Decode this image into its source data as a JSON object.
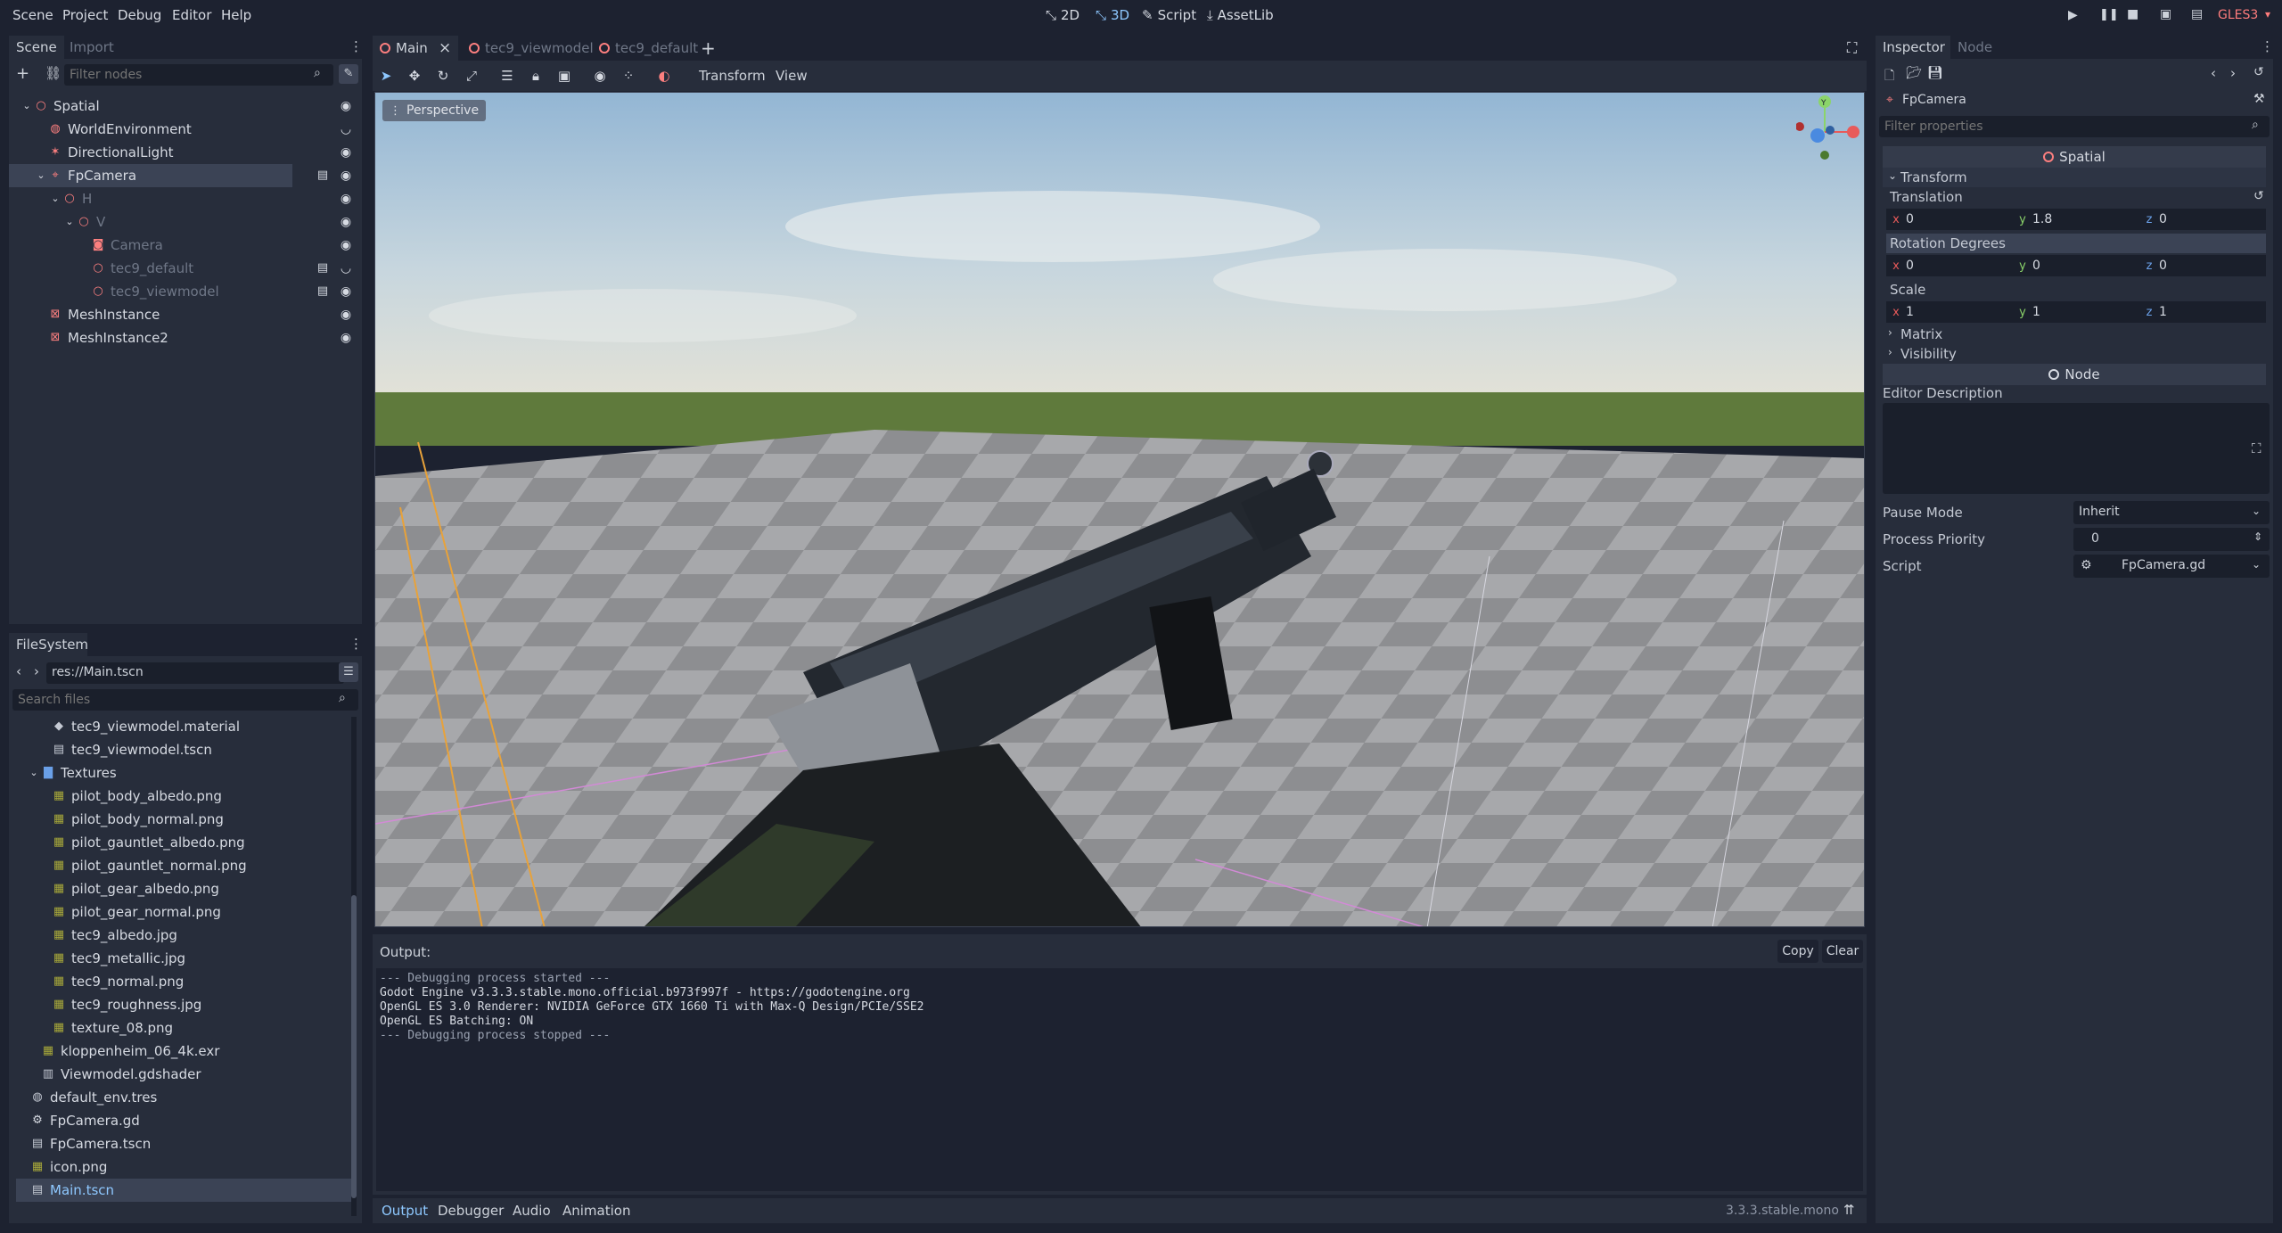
{
  "menu": [
    "Scene",
    "Project",
    "Debug",
    "Editor",
    "Help"
  ],
  "modes": {
    "m2d": "2D",
    "m3d": "3D",
    "script": "Script",
    "assetlib": "AssetLib"
  },
  "renderer": "GLES3",
  "scene_dock": {
    "tabs": [
      "Scene",
      "Import"
    ],
    "filter_placeholder": "Filter nodes",
    "nodes": [
      {
        "label": "Spatial",
        "depth": 0,
        "icon": "spatial-icon",
        "color": "#fc7f7f",
        "eye": true
      },
      {
        "label": "WorldEnvironment",
        "depth": 1,
        "icon": "world-environment-icon",
        "color": "#fc7f7f",
        "eye": false
      },
      {
        "label": "DirectionalLight",
        "depth": 1,
        "icon": "directional-light-icon",
        "color": "#fc7f7f",
        "eye": true
      },
      {
        "label": "FpCamera",
        "depth": 1,
        "icon": "fpcamera-icon",
        "color": "#fc7f7f",
        "eye": true,
        "selected": true
      },
      {
        "label": "H",
        "depth": 2,
        "icon": "spatial-icon",
        "color": "#fc7f7f",
        "eye": true,
        "dim": true
      },
      {
        "label": "V",
        "depth": 3,
        "icon": "spatial-icon",
        "color": "#fc7f7f",
        "eye": true,
        "dim": true
      },
      {
        "label": "Camera",
        "depth": 4,
        "icon": "camera-icon",
        "color": "#fc7f7f",
        "eye": true,
        "dim": true
      },
      {
        "label": "tec9_default",
        "depth": 4,
        "icon": "spatial-icon",
        "color": "#fc7f7f",
        "eye": false,
        "dim": true
      },
      {
        "label": "tec9_viewmodel",
        "depth": 4,
        "icon": "spatial-icon",
        "color": "#fc7f7f",
        "eye": true,
        "dim": true
      },
      {
        "label": "MeshInstance",
        "depth": 1,
        "icon": "mesh-instance-icon",
        "color": "#fc7f7f",
        "eye": true
      },
      {
        "label": "MeshInstance2",
        "depth": 1,
        "icon": "mesh-instance-icon",
        "color": "#fc7f7f",
        "eye": true
      }
    ]
  },
  "filesystem": {
    "title": "FileSystem",
    "path": "res://Main.tscn",
    "search_placeholder": "Search files",
    "items": [
      {
        "label": "tec9_viewmodel.material",
        "depth": 2,
        "icon": "material-icon"
      },
      {
        "label": "tec9_viewmodel.tscn",
        "depth": 2,
        "icon": "scene-file-icon"
      },
      {
        "label": "Textures",
        "depth": 1,
        "icon": "folder-icon"
      },
      {
        "label": "pilot_body_albedo.png",
        "depth": 2,
        "icon": "image-file-icon"
      },
      {
        "label": "pilot_body_normal.png",
        "depth": 2,
        "icon": "image-file-icon"
      },
      {
        "label": "pilot_gauntlet_albedo.png",
        "depth": 2,
        "icon": "image-file-icon"
      },
      {
        "label": "pilot_gauntlet_normal.png",
        "depth": 2,
        "icon": "image-file-icon"
      },
      {
        "label": "pilot_gear_albedo.png",
        "depth": 2,
        "icon": "image-file-icon"
      },
      {
        "label": "pilot_gear_normal.png",
        "depth": 2,
        "icon": "image-file-icon"
      },
      {
        "label": "tec9_albedo.jpg",
        "depth": 2,
        "icon": "image-file-icon"
      },
      {
        "label": "tec9_metallic.jpg",
        "depth": 2,
        "icon": "image-file-icon"
      },
      {
        "label": "tec9_normal.png",
        "depth": 2,
        "icon": "image-file-icon"
      },
      {
        "label": "tec9_roughness.jpg",
        "depth": 2,
        "icon": "image-file-icon"
      },
      {
        "label": "texture_08.png",
        "depth": 2,
        "icon": "image-file-icon"
      },
      {
        "label": "kloppenheim_06_4k.exr",
        "depth": 1,
        "icon": "image-file-icon"
      },
      {
        "label": "Viewmodel.gdshader",
        "depth": 1,
        "icon": "shader-file-icon"
      },
      {
        "label": "default_env.tres",
        "depth": 0,
        "icon": "environment-file-icon"
      },
      {
        "label": "FpCamera.gd",
        "depth": 0,
        "icon": "script-file-icon"
      },
      {
        "label": "FpCamera.tscn",
        "depth": 0,
        "icon": "scene-file-icon"
      },
      {
        "label": "icon.png",
        "depth": 0,
        "icon": "image-file-icon"
      },
      {
        "label": "Main.tscn",
        "depth": 0,
        "icon": "scene-file-icon",
        "selected": true
      }
    ]
  },
  "editor_tabs": [
    "Main",
    "tec9_viewmodel",
    "tec9_default"
  ],
  "viewport_toolbar": {
    "transform": "Transform",
    "view": "View"
  },
  "viewport": {
    "perspective": "Perspective"
  },
  "output": {
    "label": "Output:",
    "copy": "Copy",
    "clear": "Clear",
    "lines": [
      "--- Debugging process started ---",
      "Godot Engine v3.3.3.stable.mono.official.b973f997f - https://godotengine.org",
      "OpenGL ES 3.0 Renderer: NVIDIA GeForce GTX 1660 Ti with Max-Q Design/PCIe/SSE2",
      "OpenGL ES Batching: ON",
      "",
      "--- Debugging process stopped ---"
    ]
  },
  "bottom_tabs": [
    "Output",
    "Debugger",
    "Audio",
    "Animation"
  ],
  "version": "3.3.3.stable.mono",
  "inspector": {
    "tabs": [
      "Inspector",
      "Node"
    ],
    "object": "FpCamera",
    "filter_placeholder": "Filter properties",
    "class_spatial": "Spatial",
    "transform": "Transform",
    "translation_label": "Translation",
    "translation": {
      "x": "0",
      "y": "1.8",
      "z": "0"
    },
    "rotation_label": "Rotation Degrees",
    "rotation": {
      "x": "0",
      "y": "0",
      "z": "0"
    },
    "scale_label": "Scale",
    "scale": {
      "x": "1",
      "y": "1",
      "z": "1"
    },
    "matrix": "Matrix",
    "visibility": "Visibility",
    "class_node": "Node",
    "editor_description": "Editor Description",
    "pause_mode_label": "Pause Mode",
    "pause_mode": "Inherit",
    "process_priority_label": "Process Priority",
    "process_priority": "0",
    "script_label": "Script",
    "script": "FpCamera.gd"
  }
}
